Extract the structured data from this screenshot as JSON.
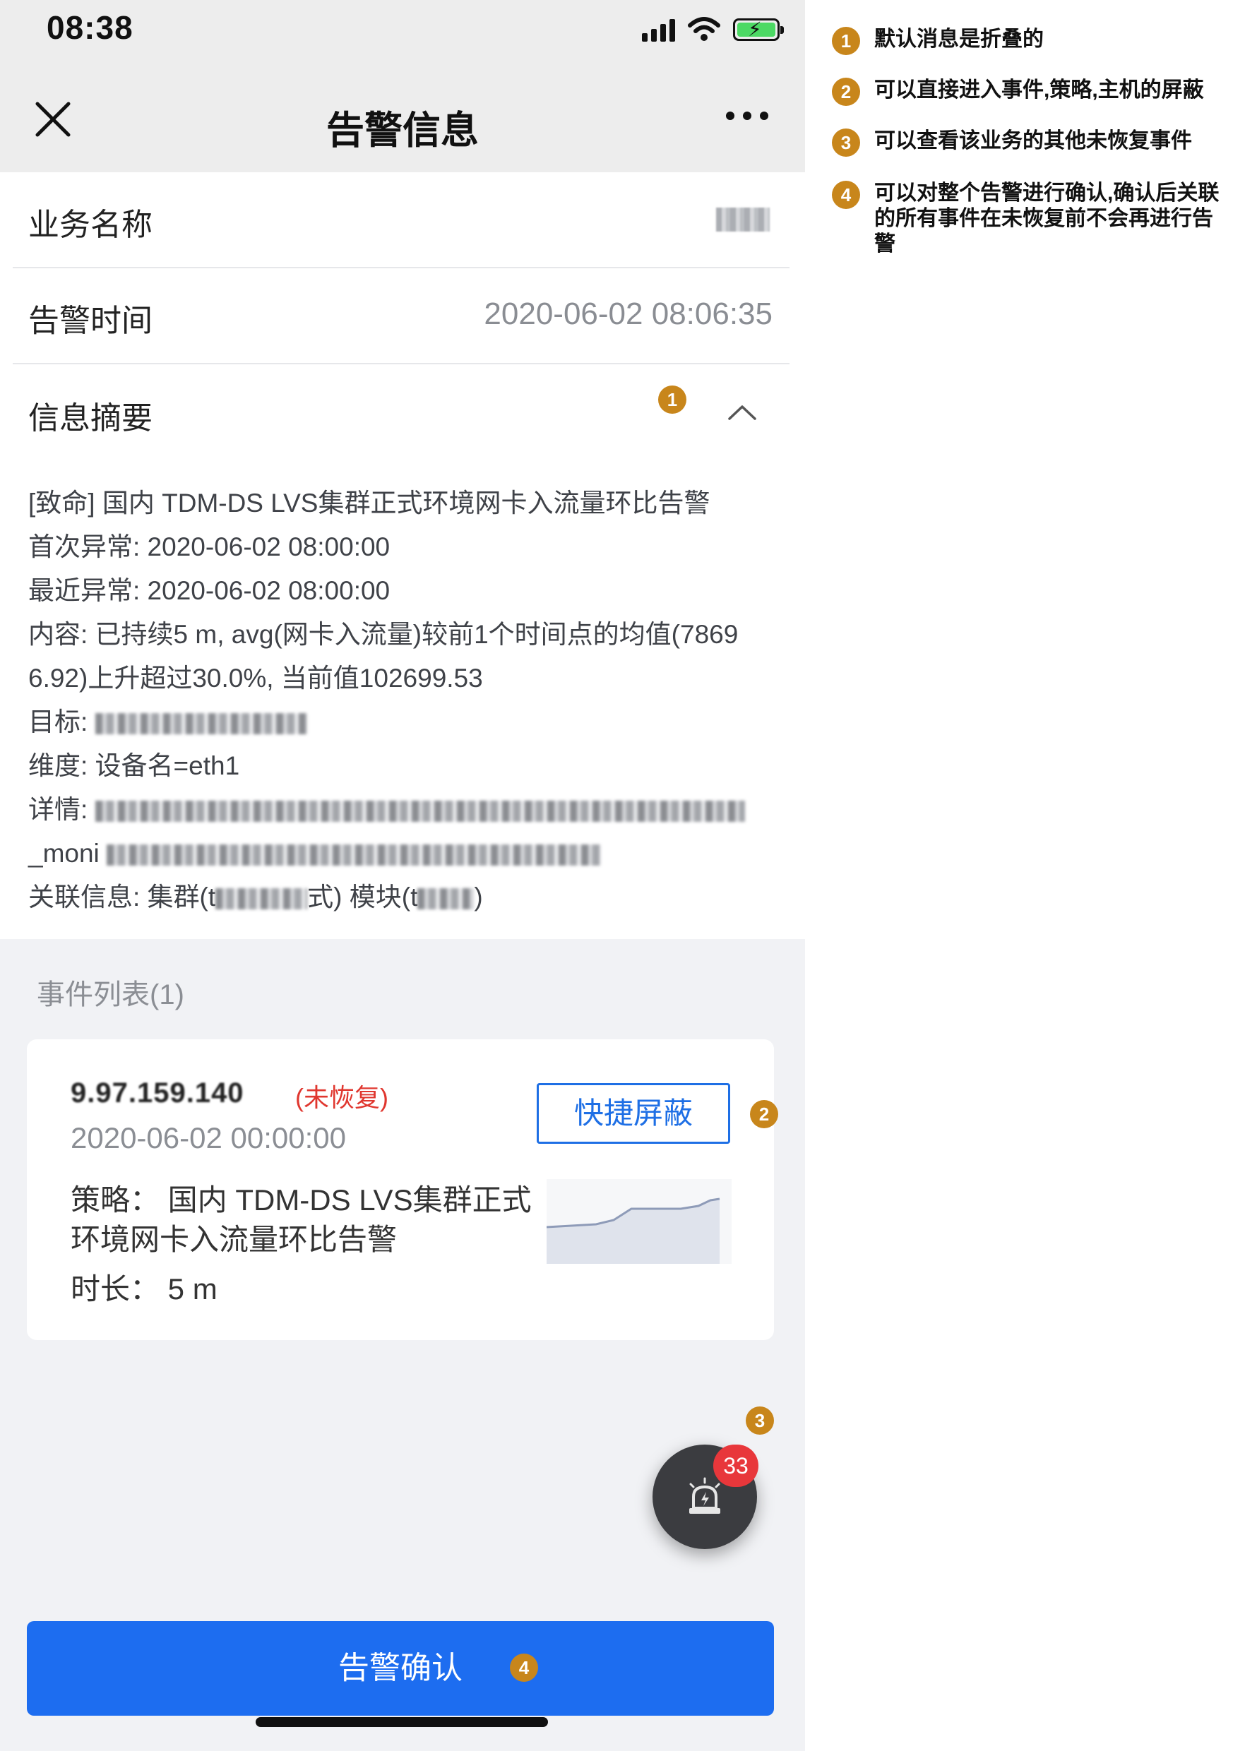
{
  "status_bar": {
    "time": "08:38"
  },
  "nav": {
    "title": "告警信息"
  },
  "info": {
    "business_name_label": "业务名称",
    "alert_time_label": "告警时间",
    "alert_time_value": "2020-06-02 08:06:35",
    "summary_label": "信息摘要"
  },
  "summary": {
    "line1": "[致命] 国内 TDM-DS LVS集群正式环境网卡入流量环比告警",
    "line2": "首次异常: 2020-06-02 08:00:00",
    "line3": "最近异常: 2020-06-02 08:00:00",
    "line4": "内容: 已持续5 m, avg(网卡入流量)较前1个时间点的均值(7869",
    "line5": "6.92)上升超过30.0%, 当前值102699.53",
    "target_label": "目标:",
    "dimension": "维度: 设备名=eth1",
    "detail_label": "详情:",
    "detail_tail": "_moni",
    "related_prefix": "关联信息: 集群(t",
    "related_mid": "式) 模块(t",
    "related_suffix": ")"
  },
  "events": {
    "title": "事件列表(1)",
    "items": [
      {
        "ip": "9.97.159.140",
        "status": "(未恢复)",
        "time": "2020-06-02 00:00:00",
        "shield_label": "快捷屏蔽",
        "policy": "策略：  国内 TDM-DS LVS集群正式环境网卡入流量环比告警",
        "duration": "时长：  5 m"
      }
    ]
  },
  "fab": {
    "count": "33"
  },
  "confirm_button": "告警确认",
  "markers": {
    "m1": "1",
    "m2": "2",
    "m3": "3",
    "m4": "4"
  },
  "notes": [
    {
      "num": "1",
      "text": "默认消息是折叠的"
    },
    {
      "num": "2",
      "text": "可以直接进入事件,策略,主机的屏蔽"
    },
    {
      "num": "3",
      "text": "可以查看该业务的其他未恢复事件"
    },
    {
      "num": "4",
      "text": "可以对整个告警进行确认,确认后关联的所有事件在未恢复前不会再进行告警"
    }
  ],
  "colors": {
    "primary": "#1d6df0",
    "danger": "#e0372f",
    "marker": "#c8861b",
    "nav_bg": "#ededed",
    "page_bg": "#f1f2f5"
  },
  "icons": [
    "signal-icon",
    "wifi-icon",
    "battery-icon",
    "close-icon",
    "more-icon",
    "chevron-up-icon",
    "siren-icon"
  ]
}
